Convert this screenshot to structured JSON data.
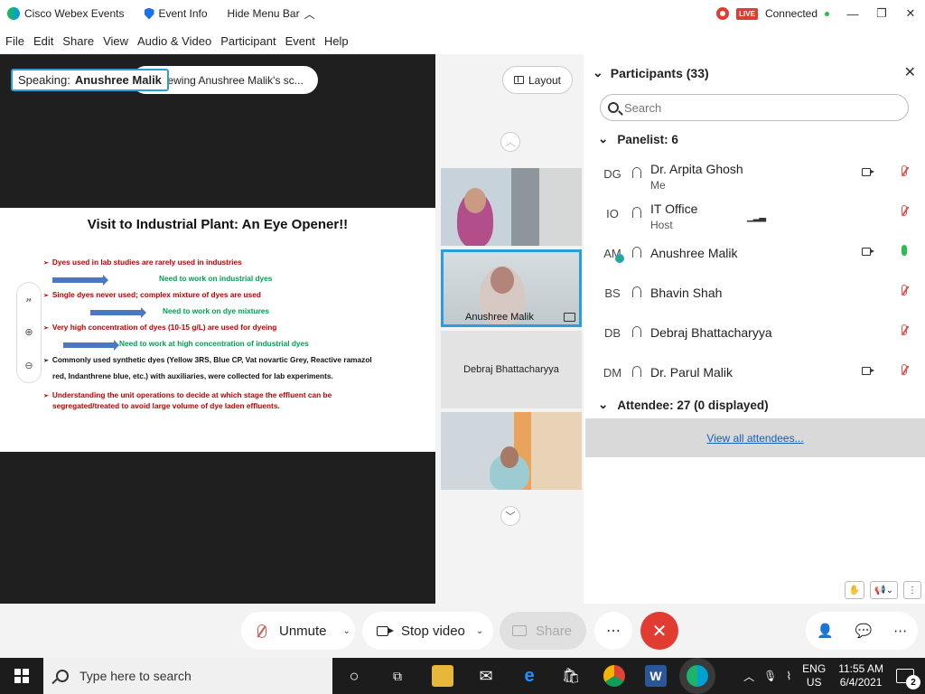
{
  "titlebar": {
    "app_name": "Cisco Webex Events",
    "event_info": "Event Info",
    "hide_menu": "Hide Menu Bar",
    "live": "LIVE",
    "status": "Connected"
  },
  "menu": [
    "File",
    "Edit",
    "Share",
    "View",
    "Audio & Video",
    "Participant",
    "Event",
    "Help"
  ],
  "stage": {
    "speaking_label": "Speaking:",
    "speaking_name": "Anushree Malik",
    "viewing_text": "Viewing Anushree Malik's sc...",
    "slide": {
      "title_bold": "Visit to Industrial Plant:",
      "title_rest": " An Eye Opener!!",
      "bullets": [
        "Dyes used in lab studies are rarely used in industries",
        "Need to work on industrial dyes",
        "Single dyes never used; complex mixture of dyes are used",
        "Need to work on dye mixtures",
        "Very high concentration of dyes (10-15 g/L) are used for dyeing",
        "Need to work at high concentration of industrial dyes",
        "Commonly used synthetic dyes (Yellow 3RS, Blue CP, Vat novartic Grey, Reactive ramazol",
        "red, Indanthrene blue, etc.) with auxiliaries, were collected for lab experiments.",
        "Understanding the unit operations to decide at which stage the effluent can be",
        "segregated/treated to avoid large volume of dye laden effluents."
      ]
    }
  },
  "strip": {
    "layout_label": "Layout",
    "tiles": [
      "",
      "Anushree Malik",
      "Debraj Bhattacharyya",
      ""
    ]
  },
  "participants": {
    "header": "Participants (33)",
    "search_placeholder": "Search",
    "panelist_header": "Panelist: 6",
    "panelists": [
      {
        "initials": "DG",
        "name": "Dr. Arpita Ghosh",
        "role": "Me"
      },
      {
        "initials": "IO",
        "name": "IT Office",
        "role": "Host"
      },
      {
        "initials": "AM",
        "name": "Anushree Malik",
        "role": ""
      },
      {
        "initials": "BS",
        "name": "Bhavin Shah",
        "role": ""
      },
      {
        "initials": "DB",
        "name": "Debraj Bhattacharyya",
        "role": ""
      },
      {
        "initials": "DM",
        "name": "Dr. Parul Malik",
        "role": ""
      }
    ],
    "attendee_header": "Attendee: 27 (0 displayed)",
    "view_all": "View all attendees..."
  },
  "controls": {
    "unmute": "Unmute",
    "stop_video": "Stop video",
    "share": "Share"
  },
  "taskbar": {
    "search_placeholder": "Type here to search",
    "lang1": "ENG",
    "lang2": "US",
    "time": "11:55 AM",
    "date": "6/4/2021",
    "notifications": "2"
  }
}
